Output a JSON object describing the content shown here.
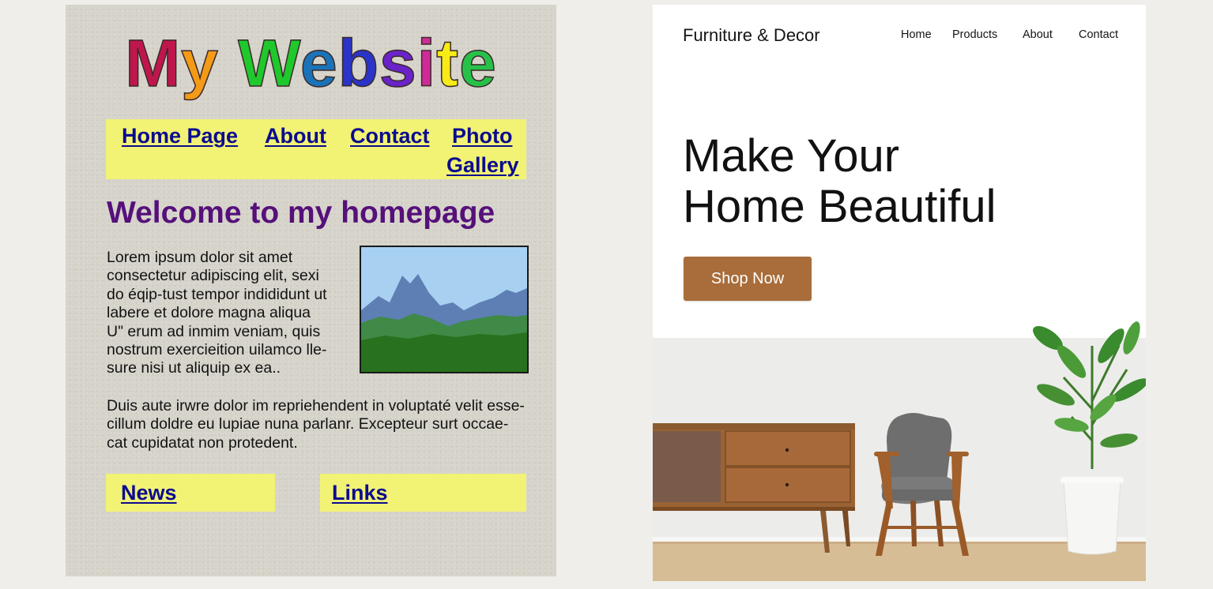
{
  "old_site": {
    "title_letters": [
      {
        "ch": "M",
        "color": "#c0164e"
      },
      {
        "ch": "y",
        "color": "#f39a16"
      },
      {
        "ch": " ",
        "color": "#000000"
      },
      {
        "ch": "W",
        "color": "#1fc92c"
      },
      {
        "ch": "e",
        "color": "#1a73b8"
      },
      {
        "ch": "b",
        "color": "#2a34c9"
      },
      {
        "ch": "s",
        "color": "#6a22c9"
      },
      {
        "ch": "i",
        "color": "#d02a9a"
      },
      {
        "ch": "t",
        "color": "#f7ea17"
      },
      {
        "ch": "e",
        "color": "#27c14a"
      }
    ],
    "nav": {
      "home": "Home Page",
      "about": "About",
      "contact": "Contact",
      "photo_line1": "Photo",
      "photo_line2": "Gallery"
    },
    "welcome": "Welcome to my homepage",
    "paragraph1": [
      "Lorem ipsum dolor sit amet",
      "consectetur adipiscing elit, sexi",
      "do éqip-tust tempor indididunt ut",
      "labere et dolore magna aliqua",
      "U\" erum ad inmim veniam, quis",
      "nostrum exercieition uilamco lle-",
      "sure nisi ut aliquip ex ea.."
    ],
    "paragraph2": [
      "Duis aute irwre dolor im repriehendent in voluptaté velit esse-",
      "cillum doldre eu lupiae nuna parlanr. Excepteur surt occae-",
      "cat cupidatat non protedent."
    ],
    "bottom_nav": {
      "news": "News",
      "links": "Links"
    },
    "colors": {
      "background": "#d6d3ca",
      "nav_background": "#f2f275",
      "link": "#0b0b8f",
      "heading": "#55107a"
    }
  },
  "new_site": {
    "brand": "Furniture & Decor",
    "nav": [
      "Home",
      "Products",
      "About",
      "Contact"
    ],
    "hero_line1": "Make Your",
    "hero_line2": "Home Beautiful",
    "cta": "Shop Now",
    "colors": {
      "background": "#ffffff",
      "cta": "#a86d3a",
      "text": "#111111"
    }
  }
}
